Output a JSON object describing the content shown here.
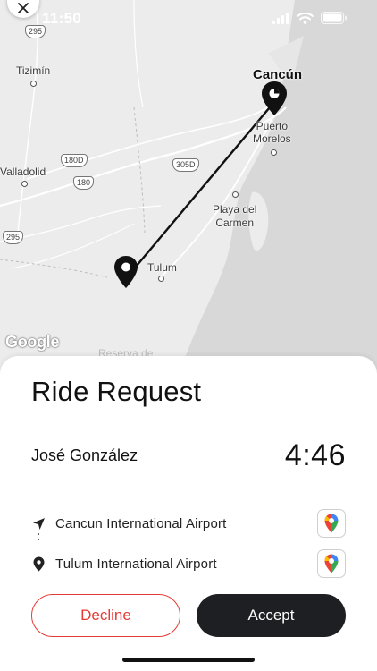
{
  "status_bar": {
    "time": "11:50"
  },
  "map": {
    "labels": {
      "cancun": "Cancún",
      "puerto_morelos": "Puerto\nMorelos",
      "tizimin": "Tizimín",
      "valladolid": "Valladolid",
      "playa": "Playa del\nCarmen",
      "tulum": "Tulum",
      "reserva": "Reserva de"
    },
    "highways": [
      "295",
      "180D",
      "180",
      "305D",
      "295"
    ],
    "attribution": "Google",
    "route_color": "#111111"
  },
  "sheet": {
    "title": "Ride Request",
    "rider_name": "José González",
    "countdown": "4:46",
    "pickup": "Cancun International Airport",
    "dropoff": "Tulum International Airport",
    "decline_label": "Decline",
    "accept_label": "Accept"
  },
  "colors": {
    "decline": "#e53b35",
    "accept_bg": "#1d1f22",
    "map_bg": "#ececec",
    "sea": "#d9d9d9"
  },
  "icons": [
    "close-icon",
    "signal-icon",
    "wifi-icon",
    "battery-icon",
    "navigation-arrow-icon",
    "location-pin-icon",
    "google-maps-icon"
  ]
}
